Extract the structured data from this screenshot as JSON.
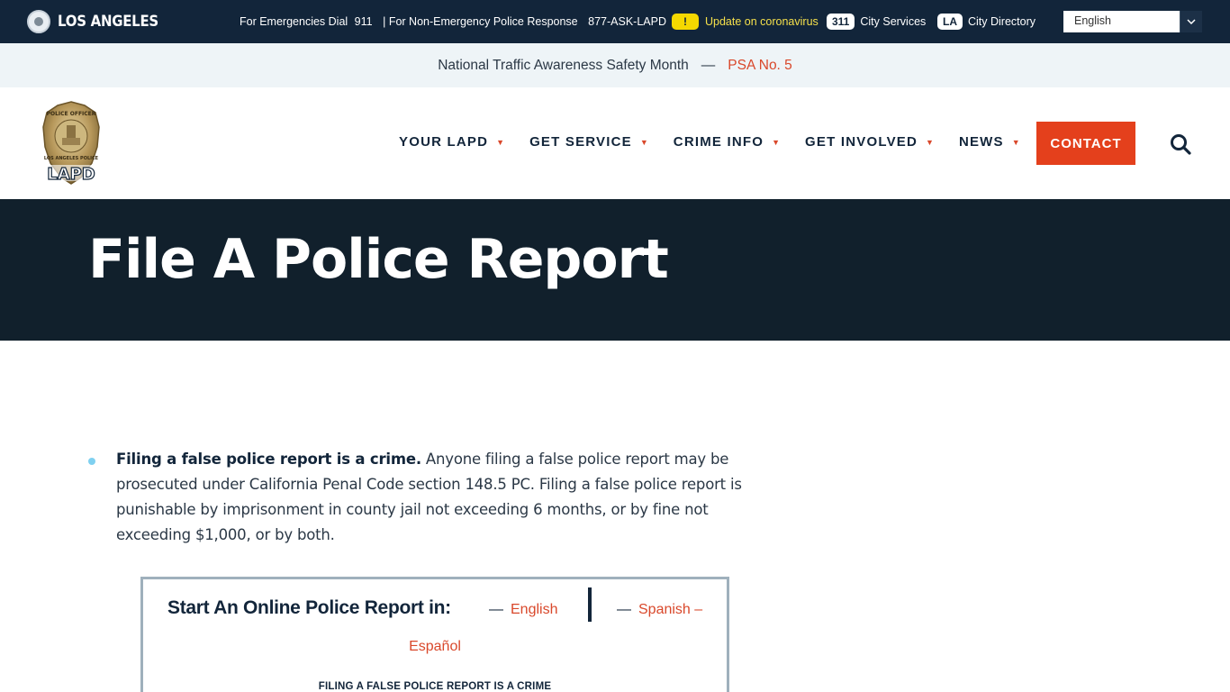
{
  "topbar": {
    "brand": "LOS ANGELES",
    "emergency_label": "For Emergencies Dial",
    "emergency_number": "911",
    "nonemergency_label": "| For Non-Emergency Police Response",
    "nonemergency_number": "877-ASK-LAPD",
    "alert_badge": "!",
    "alert_text": "Update on coronavirus",
    "services_badge": "311",
    "services_label": "City Services",
    "directory_badge": "LA",
    "directory_label": "City Directory",
    "language": "English"
  },
  "announcement": {
    "text": "National Traffic Awareness Safety Month",
    "separator": "—",
    "link": "PSA No. 5"
  },
  "header": {
    "logo_top": "POLICE OFFICER",
    "logo_ribbon": "LOS ANGELES POLICE",
    "logo_mark": "LAPD",
    "nav": [
      "YOUR LAPD",
      "GET SERVICE",
      "CRIME INFO",
      "GET INVOLVED",
      "NEWS"
    ],
    "caret": "▼",
    "contact": "CONTACT"
  },
  "hero": {
    "title": "File A Police Report"
  },
  "content": {
    "bold_lead": "Filing a false police report is a crime.",
    "body": " Anyone filing a false police report may be prosecuted under California Penal Code section 148.5 PC. Filing a false police report is punishable by imprisonment in county jail not exceeding 6 months, or by fine not exceeding $1,000, or by both.",
    "report_box": {
      "title": "Start An Online Police Report in:",
      "dash": "—",
      "english": "English",
      "spanish": "Spanish –",
      "espanol": "Español",
      "warning": "FILING A FALSE POLICE REPORT IS A CRIME"
    }
  },
  "colors": {
    "topbar_bg": "#12253a",
    "accent": "#e4401c",
    "hero_bg": "#11202c",
    "alert_yellow": "#f5d800"
  }
}
